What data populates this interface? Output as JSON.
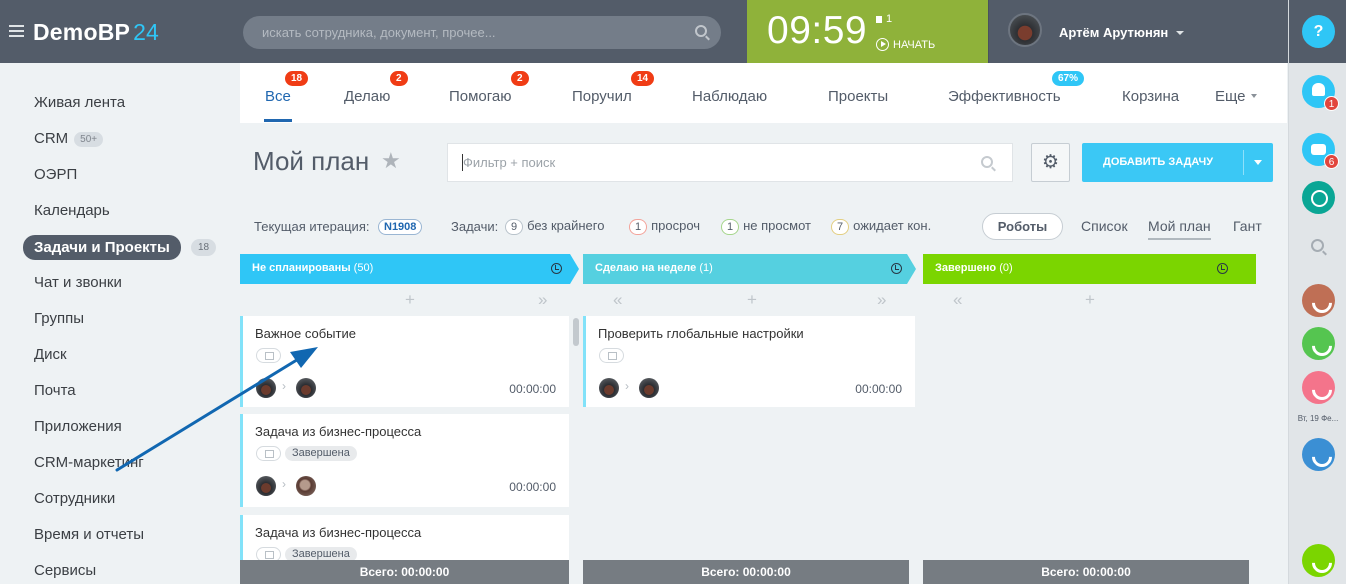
{
  "header": {
    "logo_text": "DemoBP",
    "logo_num": "24",
    "search_placeholder": "искать сотрудника, документ, прочее...",
    "clock": {
      "time": "09:59",
      "flag_count": "1",
      "start_label": "НАЧАТЬ"
    },
    "user_name": "Артём Арутюнян",
    "help_label": "?"
  },
  "right_panel": {
    "bell_count": "1",
    "bot_count": "6",
    "date_label": "Вт, 19 Фе..."
  },
  "sidebar": {
    "items": [
      {
        "label": "Живая лента"
      },
      {
        "label": "CRM",
        "count": "50+"
      },
      {
        "label": "ОЭРП"
      },
      {
        "label": "Календарь"
      },
      {
        "label": "Задачи и Проекты",
        "count": "18"
      },
      {
        "label": "Чат и звонки"
      },
      {
        "label": "Группы"
      },
      {
        "label": "Диск"
      },
      {
        "label": "Почта"
      },
      {
        "label": "Приложения"
      },
      {
        "label": "CRM-маркетинг"
      },
      {
        "label": "Сотрудники"
      },
      {
        "label": "Время и отчеты"
      },
      {
        "label": "Сервисы"
      }
    ]
  },
  "tabs": [
    {
      "label": "Все",
      "badge": "18"
    },
    {
      "label": "Делаю",
      "badge": "2"
    },
    {
      "label": "Помогаю",
      "badge": "2"
    },
    {
      "label": "Поручил",
      "badge": "14"
    },
    {
      "label": "Наблюдаю"
    },
    {
      "label": "Проекты"
    },
    {
      "label": "Эффективность",
      "badge": "67%"
    },
    {
      "label": "Корзина"
    },
    {
      "label": "Еще"
    }
  ],
  "plan": {
    "title": "Мой план",
    "filter_placeholder": "Фильтр + поиск",
    "add_task_label": "ДОБАВИТЬ ЗАДАЧУ"
  },
  "iteration": {
    "label": "Текущая итерация:",
    "id": "N1908",
    "tasks_label": "Задачи:",
    "no_deadline_count": "9",
    "no_deadline_label": "без крайнего",
    "overdue_count": "1",
    "overdue_label": "просроч",
    "unseen_count": "1",
    "unseen_label": "не просмот",
    "waiting_count": "7",
    "waiting_label": "ожидает кон."
  },
  "views": {
    "robots": "Роботы",
    "list": "Список",
    "plan": "Мой план",
    "gantt": "Гант"
  },
  "columns": [
    {
      "title": "Не спланированы",
      "count": "(50)",
      "color": "#2fc6f6",
      "cards": [
        {
          "title": "Важное событие",
          "status": "",
          "time": "00:00:00"
        },
        {
          "title": "Задача из бизнес-процесса",
          "status": "Завершена",
          "time": "00:00:00"
        },
        {
          "title": "Задача из бизнес-процесса",
          "status": "Завершена",
          "time": ""
        }
      ],
      "total": "Всего: 00:00:00"
    },
    {
      "title": "Сделаю на неделе",
      "count": "(1)",
      "color": "#55d0e0",
      "cards": [
        {
          "title": "Проверить глобальные настройки",
          "status": "",
          "time": "00:00:00"
        }
      ],
      "total": "Всего: 00:00:00"
    },
    {
      "title": "Завершено",
      "count": "(0)",
      "color": "#7bd500",
      "cards": [],
      "total": "Всего: 00:00:00"
    }
  ],
  "colors": {
    "header_bg": "#535c69",
    "clock_bg": "#8fb23a",
    "accent": "#2fc6f6",
    "badge_red": "#f03c15",
    "annotation_arrow": "#1167b1"
  }
}
